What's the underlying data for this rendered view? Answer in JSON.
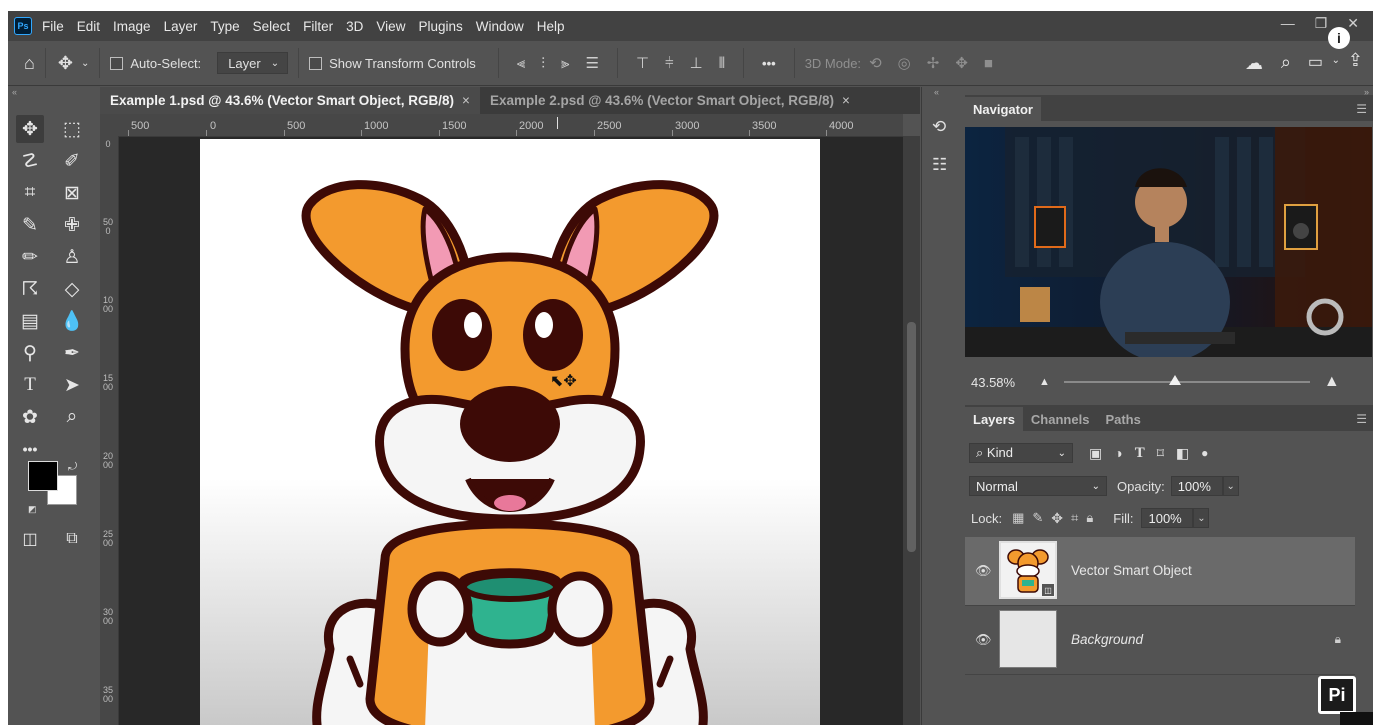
{
  "app": {
    "logo_text": "Ps"
  },
  "menu": [
    "File",
    "Edit",
    "Image",
    "Layer",
    "Type",
    "Select",
    "Filter",
    "3D",
    "View",
    "Plugins",
    "Window",
    "Help"
  ],
  "window_controls": {
    "minimize": "—",
    "restore": "❐",
    "close": "✕"
  },
  "options": {
    "auto_select_label": "Auto-Select:",
    "auto_select_target": "Layer",
    "show_transform_label": "Show Transform Controls",
    "more": "•••",
    "mode_3d_label": "3D Mode:"
  },
  "tabs": [
    {
      "label": "Example 1.psd @ 43.6% (Vector Smart Object, RGB/8)",
      "close": "×"
    },
    {
      "label": "Example 2.psd @ 43.6% (Vector Smart Object, RGB/8)",
      "close": "×"
    }
  ],
  "ruler_top": [
    "500",
    "0",
    "500",
    "1000",
    "1500",
    "2000",
    "2500",
    "3000",
    "3500",
    "4000"
  ],
  "ruler_left": [
    "0",
    "500",
    "1000",
    "1500",
    "2000",
    "2500",
    "3000",
    "3500"
  ],
  "navigator": {
    "title": "Navigator",
    "zoom": "43.58%",
    "zoom_fraction": 0.45
  },
  "layers_panel": {
    "tabs": [
      "Layers",
      "Channels",
      "Paths"
    ],
    "filter_kind": "Kind",
    "blend_mode": "Normal",
    "opacity_label": "Opacity:",
    "opacity_value": "100%",
    "lock_label": "Lock:",
    "fill_label": "Fill:",
    "fill_value": "100%",
    "layers": [
      {
        "name": "Vector Smart Object",
        "selected": true
      },
      {
        "name": "Background",
        "selected": false,
        "locked": true
      }
    ]
  },
  "watermark": "Pi",
  "info_badge": "i",
  "colors": {
    "dog_orange": "#f39a2e",
    "dog_outline": "#3d0a06",
    "ear_pink": "#f29ab4",
    "bowl_teal": "#2fb38f",
    "selected_layer": "#6a6a6a"
  }
}
